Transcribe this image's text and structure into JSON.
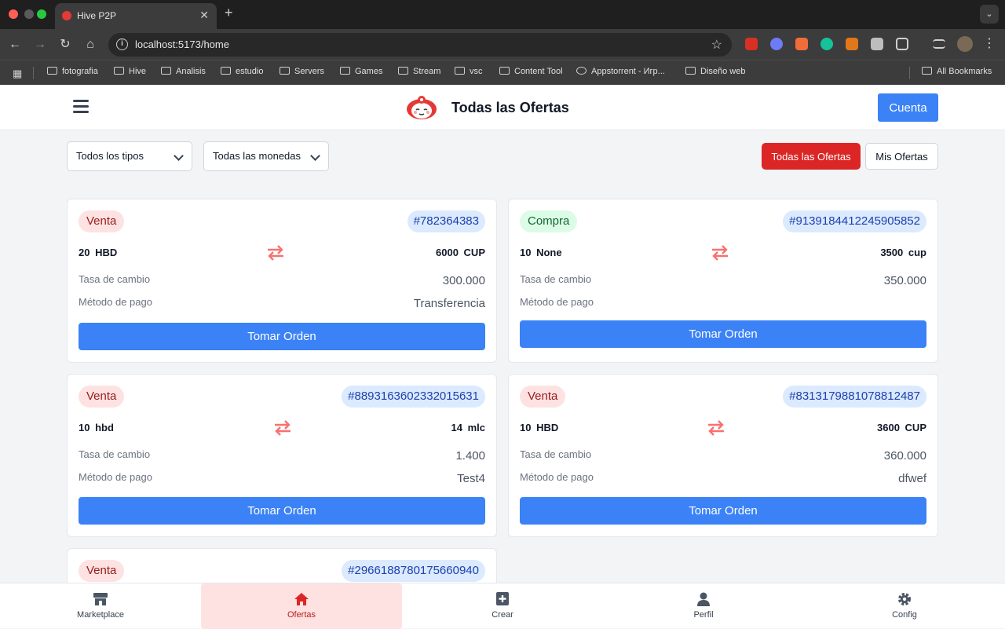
{
  "browser": {
    "tab_title": "Hive P2P",
    "tab_close": "✕",
    "new_tab": "+",
    "url": "localhost:5173/home",
    "bookmarks": [
      "fotografia",
      "Hive",
      "Analisis",
      "estudio",
      "Servers",
      "Games",
      "Stream",
      "vsc",
      "Content Tool",
      "Appstorrent - Игр...",
      "Diseño web"
    ],
    "all_bookmarks": "All Bookmarks"
  },
  "header": {
    "title": "Todas las Ofertas",
    "account_label": "Cuenta"
  },
  "filters": {
    "type_select": "Todos los tipos",
    "currency_select": "Todas las monedas",
    "all_offers_label": "Todas las Ofertas",
    "my_offers_label": "Mis Ofertas"
  },
  "offers": [
    {
      "type": "Venta",
      "id": "#782364383",
      "from_amount": "20",
      "from_currency": "HBD",
      "to_amount": "6000",
      "to_currency": "CUP",
      "rate_label": "Tasa de cambio",
      "rate": "300.000",
      "payment_label": "Método de pago",
      "payment": "Transferencia",
      "action": "Tomar Orden"
    },
    {
      "type": "Compra",
      "id": "#9139184412245905852",
      "from_amount": "10",
      "from_currency": "None",
      "to_amount": "3500",
      "to_currency": "cup",
      "rate_label": "Tasa de cambio",
      "rate": "350.000",
      "payment_label": "Método de pago",
      "payment": "",
      "action": "Tomar Orden"
    },
    {
      "type": "Venta",
      "id": "#8893163602332015631",
      "from_amount": "10",
      "from_currency": "hbd",
      "to_amount": "14",
      "to_currency": "mlc",
      "rate_label": "Tasa de cambio",
      "rate": "1.400",
      "payment_label": "Método de pago",
      "payment": "Test4",
      "action": "Tomar Orden"
    },
    {
      "type": "Venta",
      "id": "#8313179881078812487",
      "from_amount": "10",
      "from_currency": "HBD",
      "to_amount": "3600",
      "to_currency": "CUP",
      "rate_label": "Tasa de cambio",
      "rate": "360.000",
      "payment_label": "Método de pago",
      "payment": "dfwef",
      "action": "Tomar Orden"
    },
    {
      "type": "Venta",
      "id": "#2966188780175660940"
    }
  ],
  "bottom_nav": [
    {
      "label": "Marketplace",
      "icon": "store-icon"
    },
    {
      "label": "Ofertas",
      "icon": "home-icon",
      "active": true
    },
    {
      "label": "Crear",
      "icon": "plus-square-icon"
    },
    {
      "label": "Perfil",
      "icon": "user-icon"
    },
    {
      "label": "Config",
      "icon": "gear-icon"
    }
  ],
  "colors": {
    "primary": "#3b82f6",
    "danger": "#dc2626",
    "venta_bg": "#fee2e2",
    "compra_bg": "#dcfce7",
    "id_bg": "#dbeafe"
  }
}
